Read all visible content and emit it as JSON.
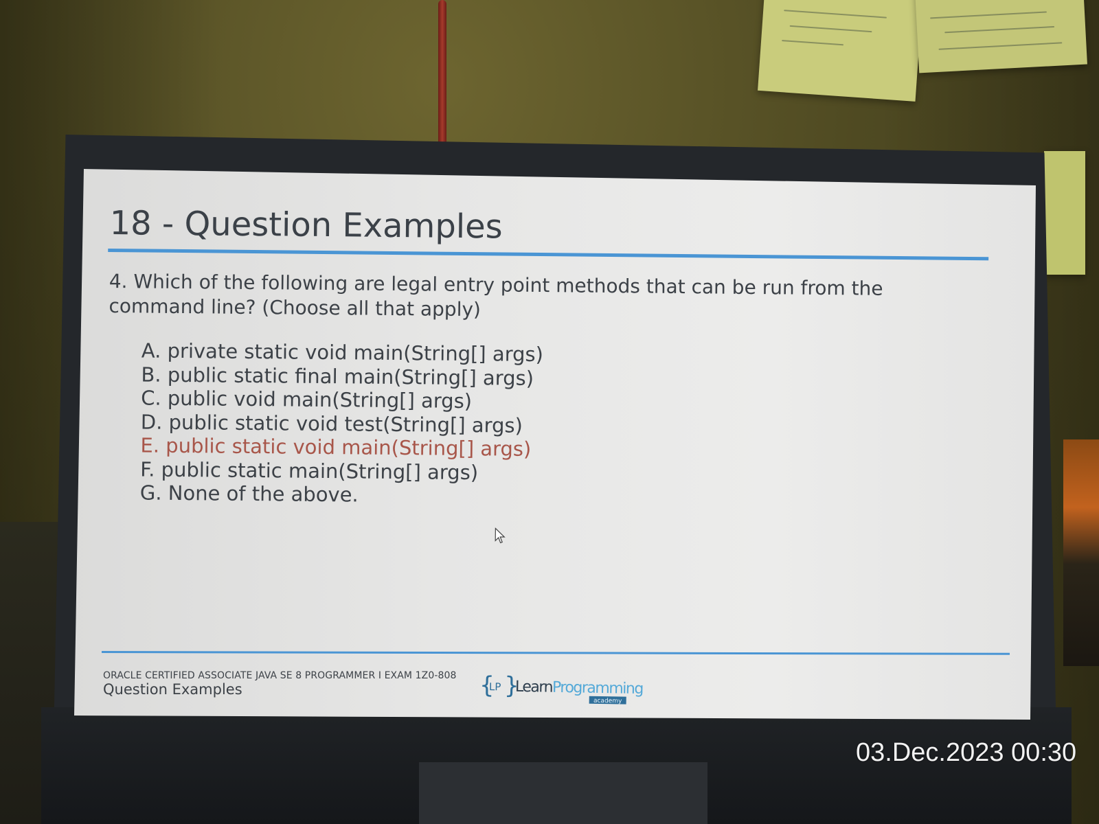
{
  "slide": {
    "title": "18 - Question Examples",
    "question": "4. Which of the following are legal entry point methods that can be run from the command line? (Choose all that apply)",
    "options": [
      "A. private static void main(String[] args)",
      "B. public static final main(String[] args)",
      "C. public void main(String[] args)",
      "D. public static void test(String[] args)",
      "E. public static void main(String[] args)",
      "F. public static main(String[] args)",
      "G. None of the above."
    ],
    "highlighted_option": "E",
    "footer": {
      "course": "ORACLE CERTIFIED ASSOCIATE JAVA SE 8 PROGRAMMER I EXAM 1Z0-808",
      "section": "Question Examples"
    },
    "logo": {
      "badge": "LP",
      "name_part1": "Learn",
      "name_part2": "Programming",
      "tagline": "academy"
    }
  },
  "photo": {
    "timestamp": "03.Dec.2023 00:30"
  },
  "colors": {
    "accent_blue": "#4a95d4",
    "highlight_red": "#a8564a",
    "text": "#3c4147"
  }
}
